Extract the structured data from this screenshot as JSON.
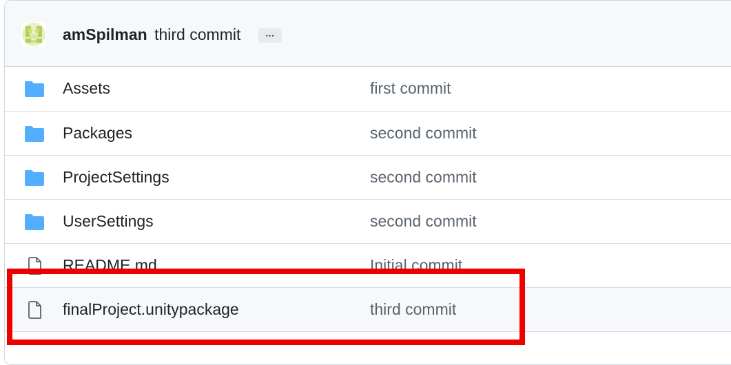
{
  "latest_commit": {
    "author": "amSpilman",
    "message": "third commit",
    "more_label": "..."
  },
  "files": [
    {
      "type": "folder",
      "icon": "folder-icon",
      "name": "Assets",
      "commit": "first commit"
    },
    {
      "type": "folder",
      "icon": "folder-icon",
      "name": "Packages",
      "commit": "second commit"
    },
    {
      "type": "folder",
      "icon": "folder-icon",
      "name": "ProjectSettings",
      "commit": "second commit"
    },
    {
      "type": "folder",
      "icon": "folder-icon",
      "name": "UserSettings",
      "commit": "second commit"
    },
    {
      "type": "file",
      "icon": "file-icon",
      "name": "README.md",
      "commit": "Initial commit"
    },
    {
      "type": "file",
      "icon": "file-icon",
      "name": "finalProject.unitypackage",
      "commit": "third commit"
    }
  ],
  "colors": {
    "folder": "#54aeff",
    "highlight": "#ee0000",
    "header_bg": "#f6f8fa"
  }
}
